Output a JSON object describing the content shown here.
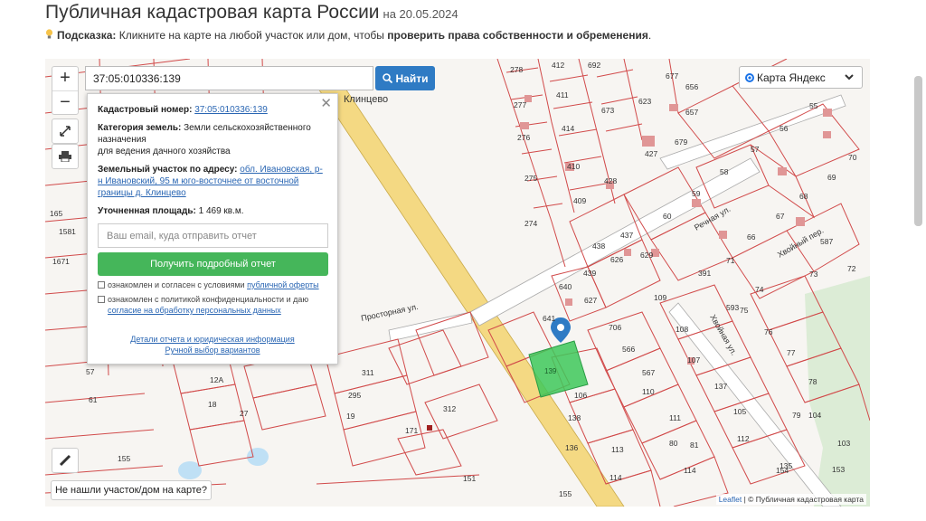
{
  "header": {
    "title": "Публичная кадастровая карта России",
    "date": "на 20.05.2024"
  },
  "hint": {
    "label": "Подсказка:",
    "text": "Кликните на карте на любой участок или дом, чтобы",
    "bold": "проверить права собственности и обременения",
    "end": "."
  },
  "search": {
    "value": "37:05:010336:139",
    "button": "Найти"
  },
  "layer": {
    "label": "Карта Яндекс"
  },
  "popup": {
    "cad_label": "Кадастровый номер:",
    "cad_value": "37:05:010336:139",
    "cat_label": "Категория земель:",
    "cat_value": "Земли сельскохозяйственного назначения",
    "cat_value2": "для ведения дачного хозяйства",
    "addr_label": "Земельный участок по адресу:",
    "addr_value": "обл. Ивановская, р-н Ивановский, 95 м юго-восточнее от восточной границы д. Клинцево",
    "area_label": "Уточненная площадь:",
    "area_value": "1 469 кв.м.",
    "email_placeholder": "Ваш email, куда отправить отчет",
    "get_report": "Получить подробный отчет",
    "agree1_text": "ознакомлен и согласен с условиями",
    "agree1_link": "публичной оферты",
    "agree2_text": "ознакомлен с политикой конфиденциальности и даю",
    "agree2_link": "согласие на обработку персональных данных",
    "details_link": "Детали отчета и юридическая информация",
    "manual_link": "Ручной выбор вариантов"
  },
  "map_labels": {
    "village": "Клинцево",
    "street1": "Просторная ул.",
    "street2": "Речная ул.",
    "street3": "Хвойный пер.",
    "street4": "Хвойная ул.",
    "selected": "139",
    "parcels": [
      "278",
      "412",
      "692",
      "277",
      "411",
      "623",
      "677",
      "656",
      "276",
      "414",
      "673",
      "55",
      "427",
      "679",
      "657",
      "56",
      "275",
      "410",
      "57",
      "274",
      "428",
      "409",
      "58",
      "69",
      "59",
      "70",
      "60",
      "66",
      "67",
      "68",
      "438",
      "437",
      "587",
      "439",
      "626",
      "629",
      "391",
      "71",
      "73",
      "72",
      "640",
      "627",
      "109",
      "74",
      "641",
      "706",
      "108",
      "75",
      "76",
      "593",
      "566",
      "107",
      "77",
      "567",
      "110",
      "106",
      "137",
      "138",
      "78",
      "79",
      "111",
      "105",
      "136",
      "104",
      "80",
      "112",
      "113",
      "135",
      "103",
      "81",
      "114",
      "114",
      "153",
      "154",
      "151",
      "155",
      "311",
      "312",
      "295",
      "19",
      "61",
      "27",
      "57",
      "155",
      "171",
      "165",
      "1581",
      "1671",
      "12A",
      "18"
    ]
  },
  "not_found": "Не нашли участок/дом на карте?",
  "attribution": {
    "leaflet": "Leaflet",
    "text": "| © Публичная кадастровая карта"
  },
  "colors": {
    "parcel_border": "#d14a4a",
    "selected_fill": "#3ec85a",
    "road": "#f4d983",
    "button_blue": "#2f7bc4",
    "button_green": "#45b65a",
    "forest": "#dcecd6"
  }
}
